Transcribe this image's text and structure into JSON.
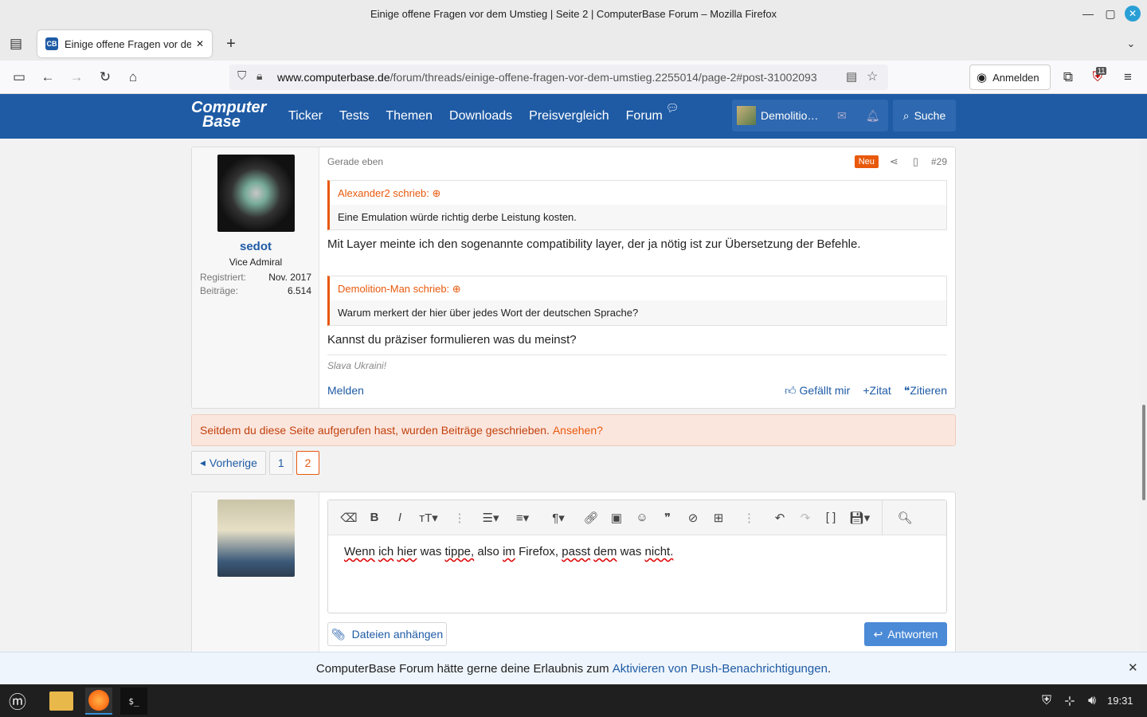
{
  "window": {
    "title": "Einige offene Fragen vor dem Umstieg | Seite 2 | ComputerBase Forum – Mozilla Firefox"
  },
  "tab": {
    "title": "Einige offene Fragen vor dem Umstieg | Seite 2",
    "favicon": "CB"
  },
  "url": {
    "host": "www.computerbase.de",
    "path": "/forum/threads/einige-offene-fragen-vor-dem-umstieg.2255014/page-2#post-31002093"
  },
  "browser": {
    "signin_label": "Anmelden",
    "ext_badge": "11"
  },
  "site": {
    "logo_top": "Computer",
    "logo_bottom": "Base",
    "nav": [
      "Ticker",
      "Tests",
      "Themen",
      "Downloads",
      "Preisvergleich",
      "Forum"
    ],
    "user": "Demolitio…",
    "search_label": "Suche"
  },
  "post": {
    "author": "sedot",
    "author_title": "Vice Admiral",
    "registered_label": "Registriert:",
    "registered_value": "Nov. 2017",
    "posts_label": "Beiträge:",
    "posts_value": "6.514",
    "time": "Gerade eben",
    "badge": "Neu",
    "number": "#29",
    "quote1_author": "Alexander2 schrieb:",
    "quote1_text": "Eine Emulation würde richtig derbe Leistung kosten.",
    "text1": "Mit Layer meinte ich den sogenannte compatibility layer, der ja nötig ist zur Übersetzung der Befehle.",
    "quote2_author": "Demolition-Man schrieb:",
    "quote2_text": "Warum merkert der hier über jedes Wort der deutschen Sprache?",
    "text2": "Kannst du präziser formulieren was du meinst?",
    "signature": "Slava Ukraini!",
    "report": "Melden",
    "like": "Gefällt mir",
    "quote_plus": "Zitat",
    "reply_quote": "Zitieren"
  },
  "notice": {
    "text": "Seitdem du diese Seite aufgerufen hast, wurden Beiträge geschrieben.",
    "link": "Ansehen?"
  },
  "pager": {
    "prev": "Vorherige",
    "pages": [
      "1",
      "2"
    ]
  },
  "reply": {
    "text_words": [
      "Wenn",
      "ich",
      "hier",
      "was",
      "tippe,",
      "also",
      "im",
      "Firefox,",
      "passt",
      "dem",
      "was",
      "nicht."
    ],
    "attach_label": "Dateien anhängen",
    "submit_label": "Antworten"
  },
  "push": {
    "text": "ComputerBase Forum hätte gerne deine Erlaubnis zum",
    "link": "Aktivieren von Push-Benachrichtigungen",
    "end": "."
  },
  "taskbar": {
    "clock": "19:31"
  }
}
